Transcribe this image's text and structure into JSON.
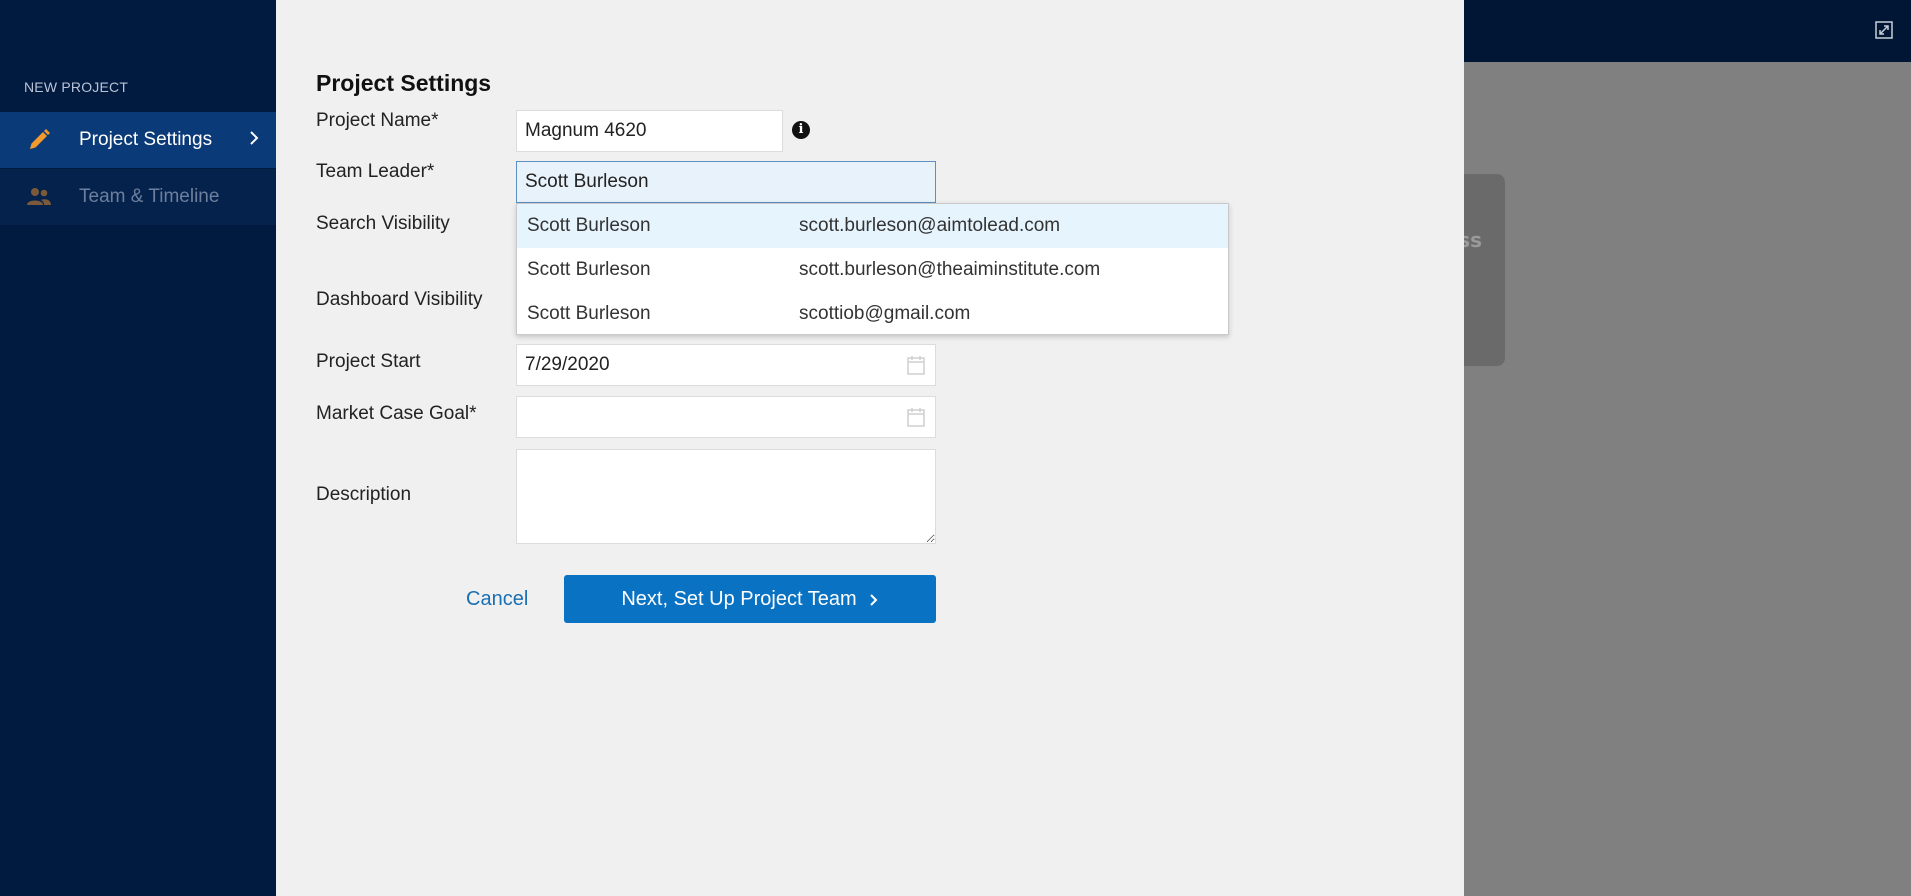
{
  "sidebar": {
    "section_title": "NEW PROJECT",
    "items": [
      {
        "label": "Project Settings",
        "icon": "pencil-icon",
        "active": true
      },
      {
        "label": "Team & Timeline",
        "icon": "people-icon",
        "active": false
      }
    ]
  },
  "form": {
    "title": "Project Settings",
    "project_name": {
      "label": "Project Name*",
      "value": "Magnum 4620"
    },
    "team_leader": {
      "label": "Team Leader*",
      "value": "Scott Burleson"
    },
    "search_visibility": {
      "label": "Search Visibility"
    },
    "dashboard_visibility": {
      "label": "Dashboard Visibility"
    },
    "project_start": {
      "label": "Project Start",
      "value": "7/29/2020"
    },
    "market_case_goal": {
      "label": "Market Case Goal*",
      "value": ""
    },
    "description": {
      "label": "Description",
      "value": ""
    }
  },
  "autocomplete": {
    "options": [
      {
        "name": "Scott Burleson",
        "email": "scott.burleson@aimtolead.com"
      },
      {
        "name": "Scott Burleson",
        "email": "scott.burleson@theaiminstitute.com"
      },
      {
        "name": "Scott Burleson",
        "email": "scottiob@gmail.com"
      }
    ]
  },
  "actions": {
    "cancel_label": "Cancel",
    "next_label": "Next, Set Up Project Team"
  },
  "background": {
    "card_fragment": "ss"
  },
  "colors": {
    "sidebar_bg": "#011a40",
    "active_item_bg": "#0a3a78",
    "accent_icon": "#f29a2e",
    "primary_button": "#0a72c3",
    "link": "#1a6fb3"
  }
}
